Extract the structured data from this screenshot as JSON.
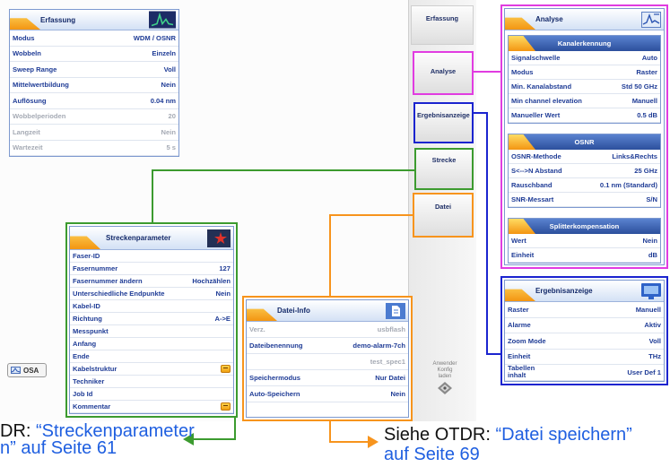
{
  "acquisition": {
    "title": "Erfassung",
    "icon": "spectrum-icon",
    "rows": [
      {
        "label": "Modus",
        "value": "WDM / OSNR"
      },
      {
        "label": "Wobbeln",
        "value": "Einzeln"
      },
      {
        "label": "Sweep Range",
        "value": "Voll"
      },
      {
        "label": "Mittelwertbildung",
        "value": "Nein"
      },
      {
        "label": "Auflösung",
        "value": "0.04 nm"
      },
      {
        "label": "Wobbelperioden",
        "value": "20",
        "disabled": true
      },
      {
        "label": "Langzeit",
        "value": "Nein",
        "disabled": true
      },
      {
        "label": "Wartezeit",
        "value": "5 s",
        "disabled": true
      }
    ]
  },
  "tabs": [
    {
      "label": "Erfassung"
    },
    {
      "label": "Analyse"
    },
    {
      "label": "Ergebnisanzeige"
    },
    {
      "label": "Strecke"
    },
    {
      "label": "Datei"
    }
  ],
  "user_config": {
    "lines": [
      "Anwender",
      "Konfig",
      "laden"
    ],
    "icon": "user-config-icon"
  },
  "mode_badge": {
    "label": "OSA",
    "icon": "osa-icon"
  },
  "analysis": {
    "title": "Analyse",
    "icon": "analysis-icon",
    "sections": [
      {
        "title": "Kanalerkennung",
        "rows": [
          {
            "label": "Signalschwelle",
            "value": "Auto"
          },
          {
            "label": "Modus",
            "value": "Raster"
          },
          {
            "label": "Min. Kanalabstand",
            "value": "Std 50 GHz"
          },
          {
            "label": "Min channel elevation",
            "value": "Manuell"
          },
          {
            "label": "Manueller Wert",
            "value": "0.5 dB"
          }
        ]
      },
      {
        "title": "OSNR",
        "rows": [
          {
            "label": "OSNR-Methode",
            "value": "Links&Rechts"
          },
          {
            "label": "S<-->N Abstand",
            "value": "25 GHz"
          },
          {
            "label": "Rauschband",
            "value": "0.1 nm (Standard)"
          },
          {
            "label": "SNR-Messart",
            "value": "S/N"
          }
        ]
      },
      {
        "title": "Splitterkompensation",
        "rows": [
          {
            "label": "Wert",
            "value": "Nein"
          },
          {
            "label": "Einheit",
            "value": "dB"
          }
        ]
      }
    ]
  },
  "results": {
    "title": "Ergebnisanzeige",
    "icon": "display-icon",
    "rows": [
      {
        "label": "Raster",
        "value": "Manuell"
      },
      {
        "label": "Alarme",
        "value": "Aktiv"
      },
      {
        "label": "Zoom Mode",
        "value": "Voll"
      },
      {
        "label": "Einheit",
        "value": "THz"
      },
      {
        "label": "Tabellen inhalt",
        "value": "User Def 1"
      }
    ]
  },
  "link_params": {
    "title": "Streckenparameter",
    "icon": "fiber-link-icon",
    "rows": [
      {
        "label": "Faser-ID"
      },
      {
        "label": "Fasernummer",
        "value": "127"
      },
      {
        "label": "Fasernummer ändern",
        "value": "Hochzählen"
      },
      {
        "label": "Unterschiedliche Endpunkte",
        "value": "Nein"
      },
      {
        "label": "Kabel-ID"
      },
      {
        "label": "Richtung",
        "value": "A->E"
      },
      {
        "label": "Messpunkt"
      },
      {
        "label": "Anfang"
      },
      {
        "label": "Ende"
      },
      {
        "label": "Kabelstruktur",
        "icon": "edit-icon"
      },
      {
        "label": "Techniker"
      },
      {
        "label": "Job Id"
      },
      {
        "label": "Kommentar",
        "icon": "edit-icon"
      }
    ]
  },
  "file_info": {
    "title": "Datei-Info",
    "icon": "file-icon",
    "rows": [
      {
        "label": "Verz.",
        "value": "usbflash",
        "disabled": true
      },
      {
        "label": "Dateibenennung",
        "value": "demo-alarm-7ch"
      },
      {
        "value": "test_spec1",
        "disabled": true
      },
      {
        "label": "Speichermodus",
        "value": "Nur Datei"
      },
      {
        "label": "Auto-Speichern",
        "value": "Nein"
      }
    ]
  },
  "references": {
    "link": {
      "prefix": "DR: ",
      "line1": "“Streckenparameter",
      "line2": "n” auf Seite 61"
    },
    "file": {
      "prefix": "Siehe OTDR: ",
      "line1": "“Datei speichern”",
      "line2": "auf Seite 69"
    }
  },
  "colors": {
    "analysis_callout": "#e13ce1",
    "results_callout": "#1b24cf",
    "link_callout": "#3c9b2f",
    "file_callout": "#f7941d",
    "setting_text": "#1f3c96",
    "reference_link": "#1f5fe0"
  }
}
